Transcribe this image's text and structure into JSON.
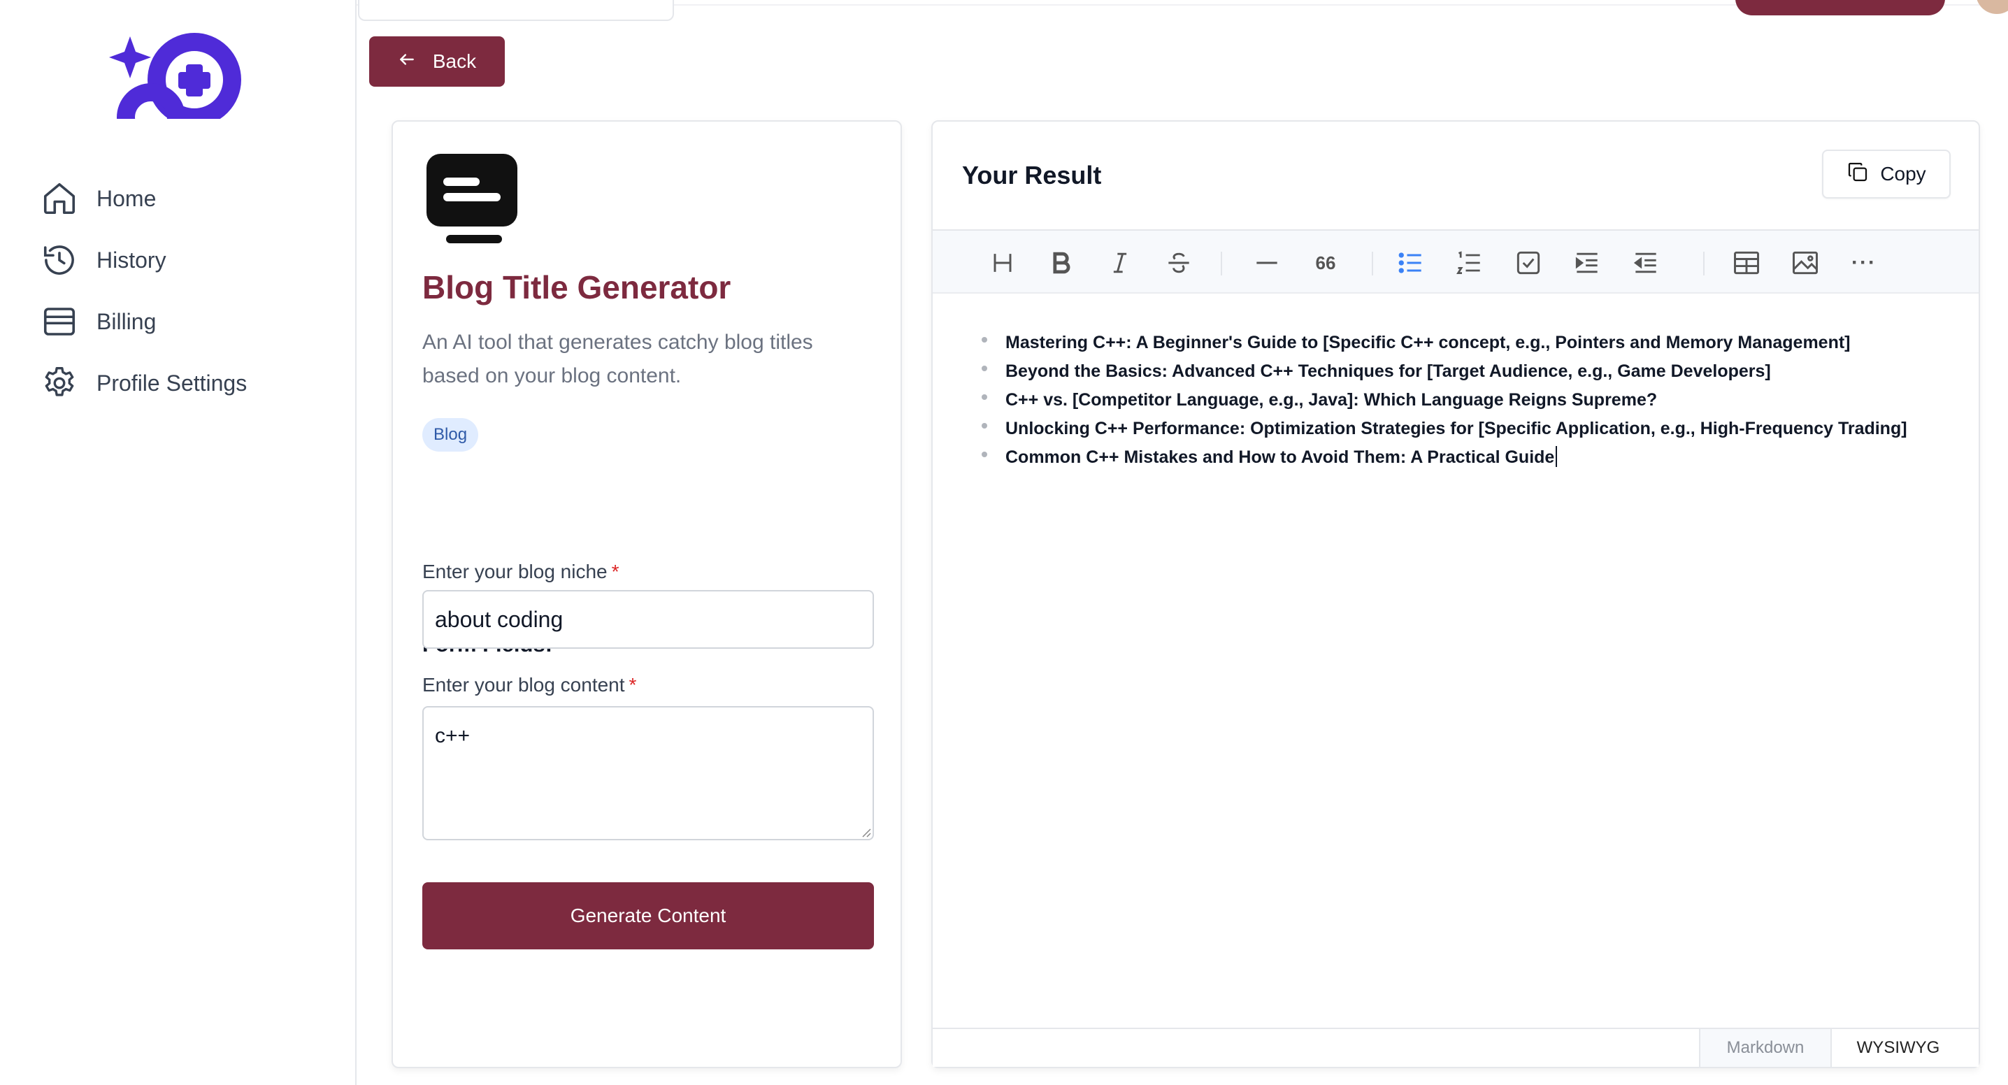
{
  "sidebar": {
    "items": [
      {
        "label": "Home",
        "icon": "home-icon"
      },
      {
        "label": "History",
        "icon": "history-icon"
      },
      {
        "label": "Billing",
        "icon": "billing-icon"
      },
      {
        "label": "Profile Settings",
        "icon": "gear-icon"
      }
    ]
  },
  "header": {
    "back_label": "Back"
  },
  "tool": {
    "title": "Blog Title Generator",
    "description": "An AI tool that generates catchy blog titles based on your blog content.",
    "tag": "Blog",
    "form_fields_title": "Form Fields:",
    "niche_label": "Enter your blog niche",
    "niche_value": "about coding",
    "content_label": "Enter your blog content",
    "content_value": "c++",
    "required_mark": "*",
    "generate_label": "Generate Content"
  },
  "result": {
    "title": "Your Result",
    "copy_label": "Copy",
    "items": [
      "Mastering C++: A Beginner's Guide to [Specific C++ concept, e.g.,  Pointers and Memory Management]",
      "Beyond the Basics: Advanced C++ Techniques for [Target Audience, e.g., Game Developers]",
      "C++ vs. [Competitor Language, e.g., Java]: Which Language Reigns Supreme?",
      "Unlocking C++ Performance: Optimization Strategies for [Specific Application, e.g.,  High-Frequency Trading]",
      "Common C++ Mistakes and How to Avoid Them: A Practical Guide"
    ],
    "toolbar": {
      "quote_glyph": "66",
      "more_glyph": "···"
    },
    "modes": {
      "markdown": "Markdown",
      "wysiwyg": "WYSIWYG"
    }
  },
  "colors": {
    "brand": "#7d2a3f",
    "logo": "#4f2bd8",
    "tag_bg": "#e0ecff",
    "active_toolbar": "#3b82f6"
  }
}
